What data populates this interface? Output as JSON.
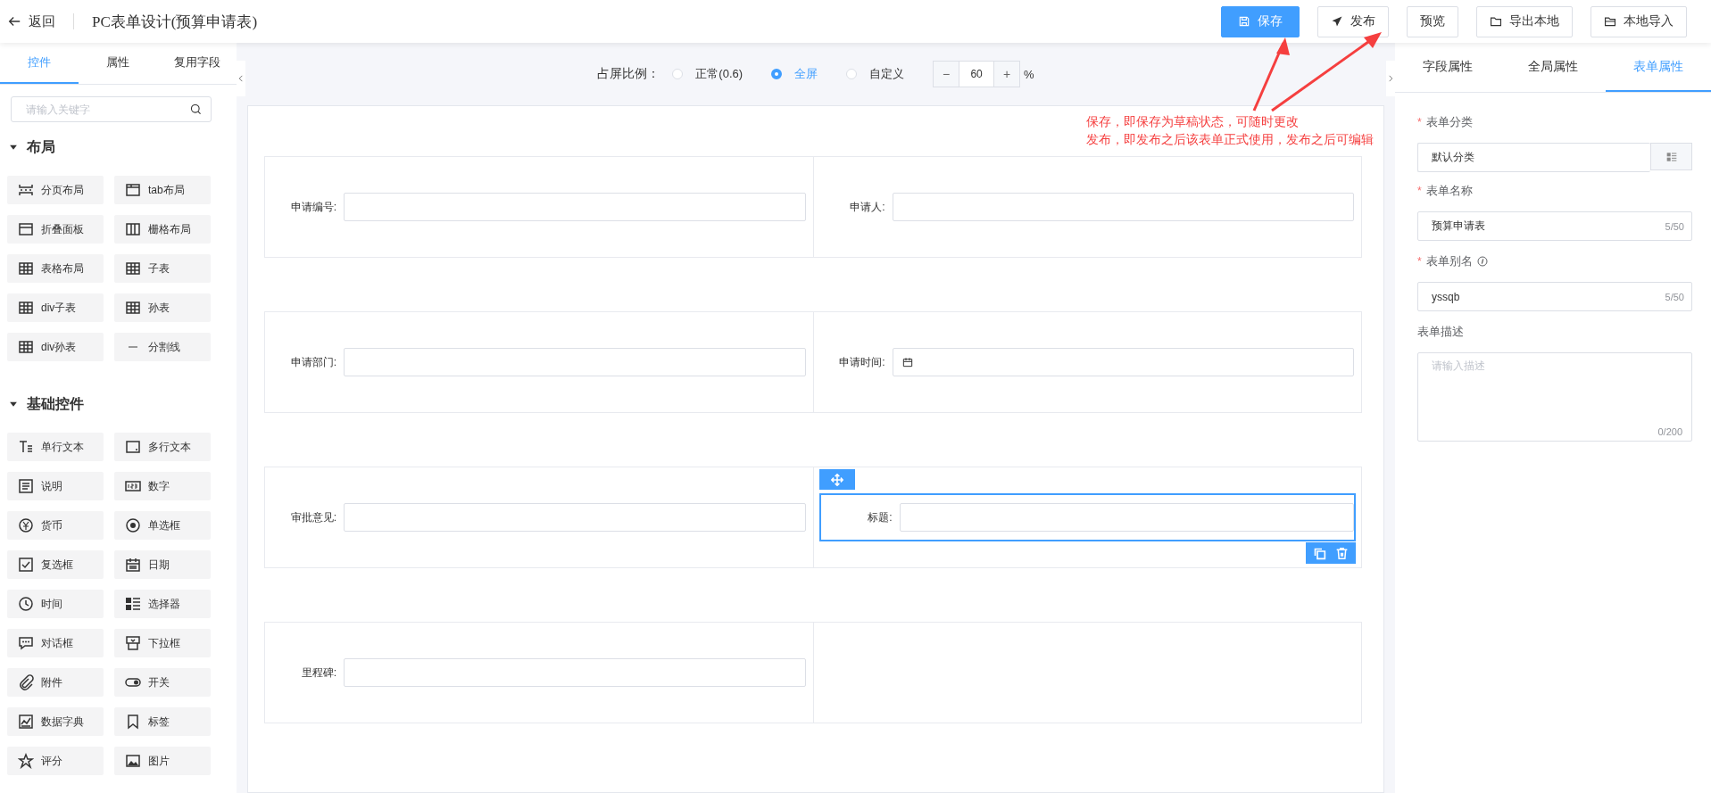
{
  "header": {
    "back": "返回",
    "title": "PC表单设计(预算申请表)",
    "buttons": [
      {
        "label": "保存",
        "kind": "primary"
      },
      {
        "label": "发布",
        "kind": "default"
      },
      {
        "label": "预览",
        "kind": "default"
      },
      {
        "label": "导出本地",
        "kind": "default"
      },
      {
        "label": "本地导入",
        "kind": "default"
      }
    ]
  },
  "sidebar": {
    "tabs": [
      {
        "label": "控件",
        "selected": true
      },
      {
        "label": "属性",
        "selected": false
      },
      {
        "label": "复用字段",
        "selected": false
      }
    ],
    "search": {
      "placeholder": "请输入关键字"
    },
    "groups": [
      {
        "title": "布局",
        "expanded": true,
        "items": [
          "分页布局",
          "tab布局",
          "折叠面板",
          "栅格布局",
          "表格布局",
          "子表",
          "div子表",
          "孙表",
          "div孙表",
          "分割线"
        ]
      },
      {
        "title": "基础控件",
        "expanded": true,
        "items": [
          "单行文本",
          "多行文本",
          "说明",
          "数字",
          "货币",
          "单选框",
          "复选框",
          "日期",
          "时间",
          "选择器",
          "对话框",
          "下拉框",
          "附件",
          "开关",
          "数据字典",
          "标签",
          "评分",
          "图片"
        ]
      }
    ]
  },
  "toolbar": {
    "label": "占屏比例：",
    "options": [
      {
        "label": "正常(0.6)",
        "selected": false
      },
      {
        "label": "全屏",
        "selected": true
      },
      {
        "label": "自定义",
        "selected": false
      }
    ],
    "stepper": {
      "minus": "−",
      "value": "60",
      "plus": "+"
    },
    "unit": "%"
  },
  "canvas": {
    "rows": [
      {
        "cells": [
          {
            "kind": "input",
            "label": "申请编号:",
            "selected": false
          },
          {
            "kind": "input",
            "label": "申请人:",
            "selected": false
          }
        ]
      },
      {
        "cells": [
          {
            "kind": "input",
            "label": "申请部门:",
            "selected": false
          },
          {
            "kind": "date",
            "label": "申请时间:",
            "selected": false
          }
        ]
      },
      {
        "cells": [
          {
            "kind": "input",
            "label": "审批意见:",
            "selected": false
          },
          {
            "kind": "input",
            "label": "标题:",
            "selected": true
          }
        ]
      },
      {
        "cells": [
          {
            "kind": "input",
            "label": "里程碑:",
            "selected": false
          },
          {
            "kind": "empty"
          }
        ]
      }
    ]
  },
  "annotation": {
    "lines": [
      "保存，即保存为草稿状态，可随时更改",
      "发布，即发布之后该表单正式使用，发布之后可编辑"
    ]
  },
  "properties": {
    "tabs": [
      {
        "label": "字段属性",
        "selected": false
      },
      {
        "label": "全局属性",
        "selected": false
      },
      {
        "label": "表单属性",
        "selected": true
      }
    ],
    "fields": [
      {
        "kind": "select",
        "label": "表单分类",
        "required_mark": "*",
        "value": "默认分类"
      },
      {
        "kind": "input",
        "label": "表单名称",
        "required_mark": "*",
        "value": "预算申请表",
        "counter": "5/50"
      },
      {
        "kind": "input",
        "label": "表单别名",
        "required_mark": "*",
        "info": true,
        "value": "yssqb",
        "counter": "5/50"
      },
      {
        "kind": "textarea",
        "label": "表单描述",
        "placeholder": "请输入描述",
        "counter": "0/200"
      }
    ]
  }
}
